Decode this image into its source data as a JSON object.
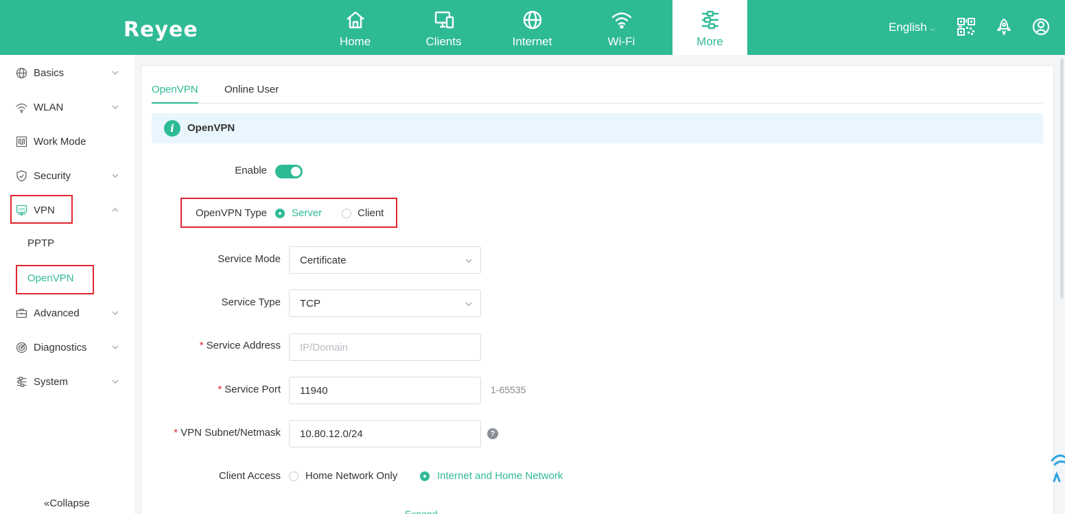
{
  "header": {
    "logo": "Reyee",
    "nav": [
      {
        "label": "Home",
        "icon": "home-icon"
      },
      {
        "label": "Clients",
        "icon": "devices-icon"
      },
      {
        "label": "Internet",
        "icon": "globe-icon"
      },
      {
        "label": "Wi-Fi",
        "icon": "wifi-icon"
      },
      {
        "label": "More",
        "icon": "more-settings-icon",
        "active": true
      }
    ],
    "language": "English",
    "icons": [
      "qr-code-icon",
      "rocket-icon",
      "user-icon"
    ]
  },
  "sidebar": {
    "items": [
      {
        "label": "Basics",
        "icon": "globe-icon"
      },
      {
        "label": "WLAN",
        "icon": "wifi-icon"
      },
      {
        "label": "Work Mode",
        "icon": "work-mode-icon"
      },
      {
        "label": "Security",
        "icon": "shield-icon"
      },
      {
        "label": "VPN",
        "icon": "vpn-icon",
        "expanded": true
      },
      {
        "label": "Advanced",
        "icon": "toolbox-icon"
      },
      {
        "label": "Diagnostics",
        "icon": "diagnostics-icon"
      },
      {
        "label": "System",
        "icon": "system-settings-icon"
      }
    ],
    "vpn_sub": [
      {
        "label": "PPTP"
      },
      {
        "label": "OpenVPN",
        "active": true
      }
    ],
    "collapse": "Collapse"
  },
  "main": {
    "tabs": [
      {
        "label": "OpenVPN",
        "active": true
      },
      {
        "label": "Online User"
      }
    ],
    "info_title": "OpenVPN",
    "form": {
      "enable_label": "Enable",
      "enable_on": true,
      "type_label": "OpenVPN Type",
      "type_options": [
        "Server",
        "Client"
      ],
      "type_selected": "Server",
      "service_mode_label": "Service Mode",
      "service_mode_value": "Certificate",
      "service_type_label": "Service Type",
      "service_type_value": "TCP",
      "service_address_label": "Service Address",
      "service_address_placeholder": "IP/Domain",
      "service_port_label": "Service Port",
      "service_port_value": "11940",
      "service_port_hint": "1-65535",
      "subnet_label": "VPN Subnet/Netmask",
      "subnet_value": "10.80.12.0/24",
      "help": "?",
      "client_access_label": "Client Access",
      "client_access_options": [
        "Home Network Only",
        "Internet and Home Network"
      ],
      "client_access_selected": "Internet and Home Network",
      "expand": "Expand"
    }
  },
  "colors": {
    "brand": "#2fba96",
    "highlight_box": "#e0262f"
  }
}
